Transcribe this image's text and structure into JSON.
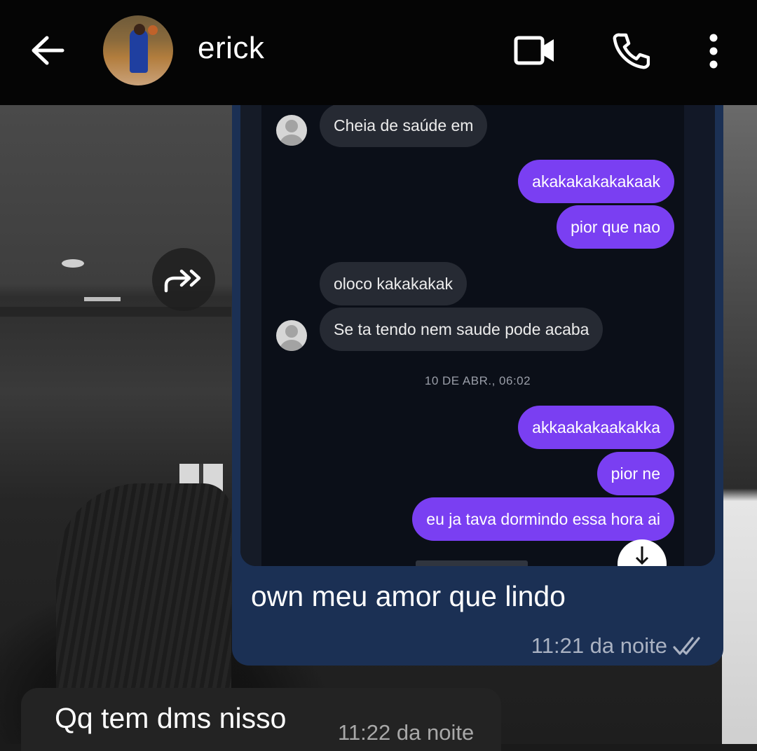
{
  "header": {
    "contact_name": "erick",
    "back_icon": "arrow-left-icon",
    "video_icon": "video-camera-icon",
    "call_icon": "phone-icon",
    "menu_icon": "more-vertical-icon"
  },
  "forward_button": {
    "icon": "forward-icon"
  },
  "outgoing_message": {
    "screenshot": {
      "messages": [
        {
          "from": "them",
          "text": "Cheia de saúde em"
        },
        {
          "from": "me",
          "text": "akakakakakakaak"
        },
        {
          "from": "me",
          "text": "pior que nao"
        },
        {
          "from": "them",
          "text": "oloco kakakakak"
        },
        {
          "from": "them",
          "text": "Se ta tendo nem saude pode acaba"
        },
        {
          "from": "me",
          "text": "akkaakakaakakka"
        },
        {
          "from": "me",
          "text": "pior ne"
        },
        {
          "from": "me",
          "text": "eu ja tava dormindo essa hora ai"
        }
      ],
      "date_separator": "10 DE ABR., 06:02"
    },
    "text": "own meu amor que lindo",
    "time": "11:21 da noite",
    "status_icon": "double-check-icon"
  },
  "incoming_message": {
    "text": "Qq tem dms nisso",
    "time": "11:22 da noite"
  },
  "colors": {
    "header_bg": "#050505",
    "outgoing_bubble": "#1b3054",
    "incoming_bubble": "#232323",
    "screenshot_sent_bubble": "#7a3ff2"
  }
}
